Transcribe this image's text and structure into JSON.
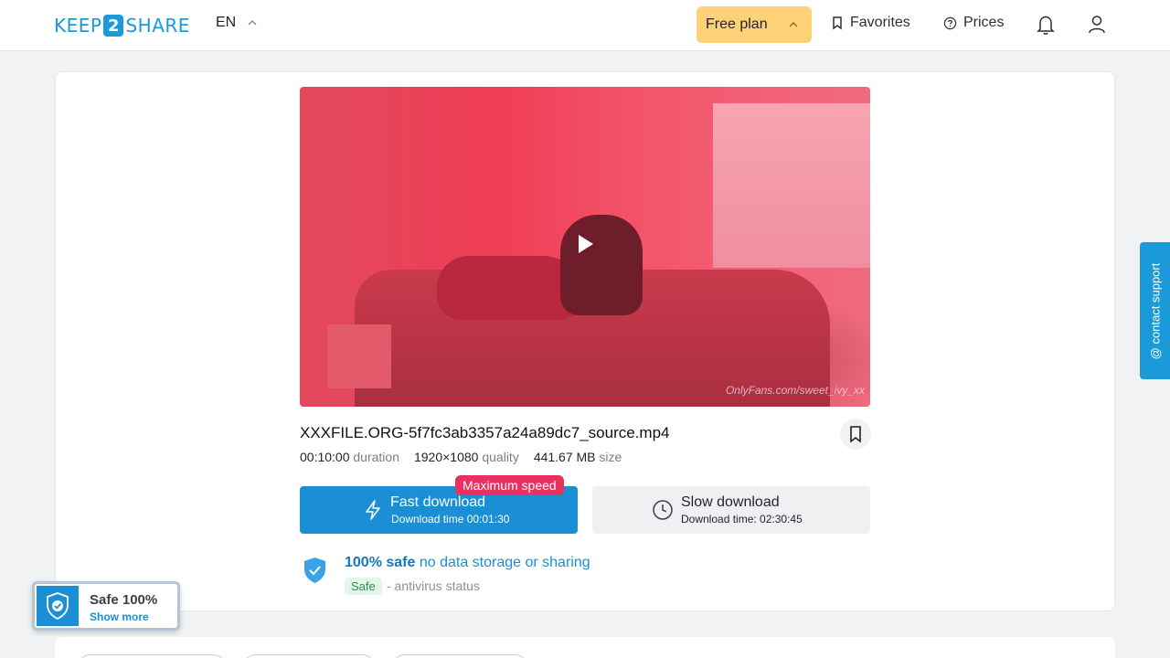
{
  "header": {
    "logo_left": "KEEP",
    "logo_num": "2",
    "logo_right": "SHARE",
    "lang": "EN",
    "plan": "Free plan",
    "favorites": "Favorites",
    "prices": "Prices"
  },
  "video": {
    "watermark": "OnlyFans.com/sweet_ivy_xx"
  },
  "file": {
    "name": "XXXFILE.ORG-5f7fc3ab3357a24a89dc7_source.mp4",
    "duration": "00:10:00",
    "duration_label": "duration",
    "quality": "1920×1080",
    "quality_label": "quality",
    "size": "441.67 MB",
    "size_label": "size"
  },
  "downloads": {
    "badge": "Maximum speed",
    "fast_title": "Fast download",
    "fast_sub": "Download time 00:01:30",
    "slow_title": "Slow download",
    "slow_sub": "Download time: 02:30:45"
  },
  "safety": {
    "bold": "100% safe",
    "rest": "no data storage or sharing",
    "badge": "Safe",
    "status": "- antivirus status"
  },
  "support": {
    "label": "@ contact support"
  },
  "widget": {
    "title": "Safe 100%",
    "link": "Show more"
  },
  "colors": {
    "accent": "#1a8fd6",
    "plan": "#fdd176",
    "badge": "#e8315f"
  }
}
